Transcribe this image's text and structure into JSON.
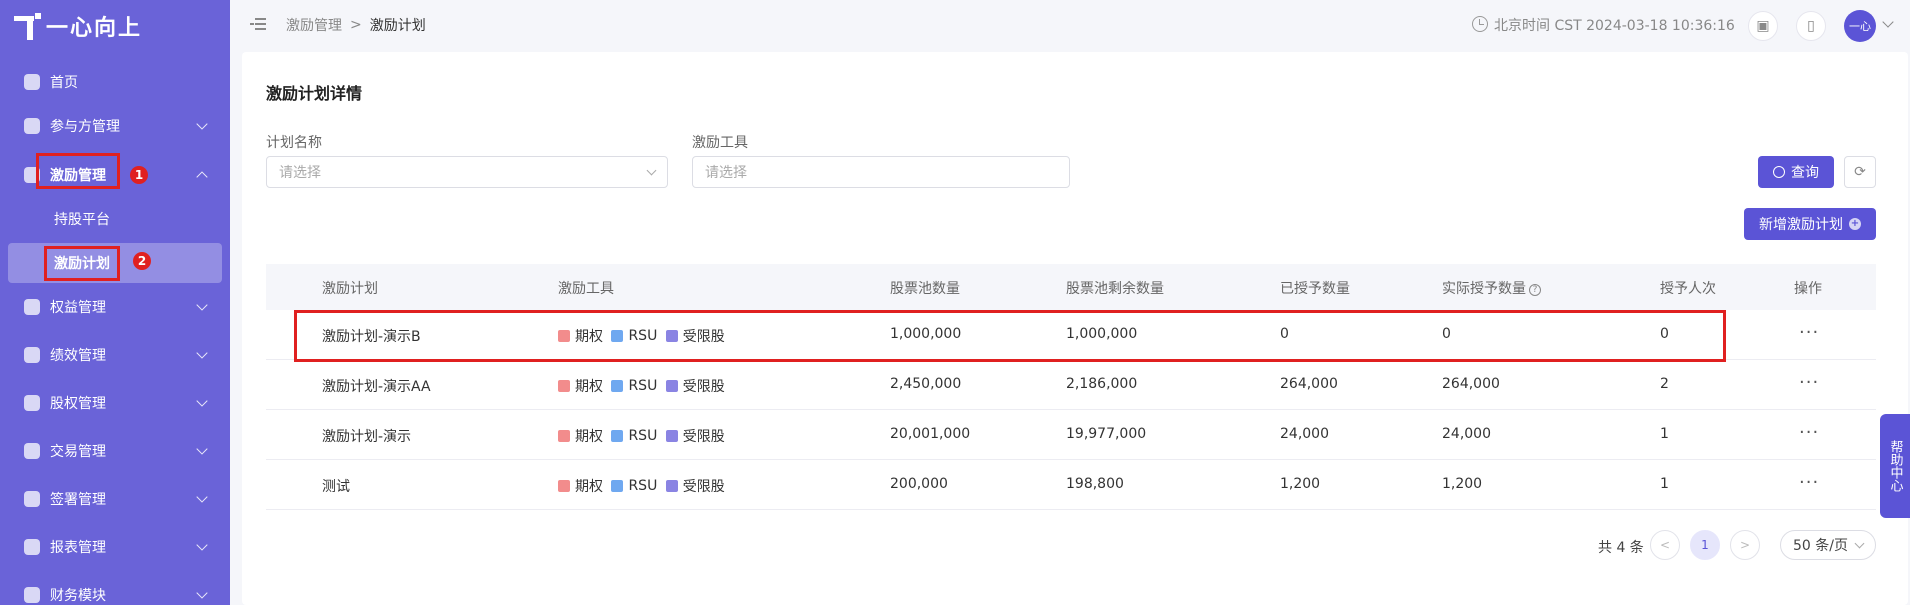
{
  "brand": {
    "logo_text": "一心向上"
  },
  "sidebar": {
    "items": [
      {
        "label": "首页",
        "icon": "home-icon"
      },
      {
        "label": "参与方管理",
        "icon": "participants-icon"
      },
      {
        "label": "激励管理",
        "icon": "incentive-icon",
        "expanded": true
      },
      {
        "label": "权益管理",
        "icon": "equity-rights-icon"
      },
      {
        "label": "绩效管理",
        "icon": "performance-icon"
      },
      {
        "label": "股权管理",
        "icon": "shares-icon"
      },
      {
        "label": "交易管理",
        "icon": "trade-icon"
      },
      {
        "label": "签署管理",
        "icon": "sign-icon"
      },
      {
        "label": "报表管理",
        "icon": "report-icon"
      },
      {
        "label": "财务模块",
        "icon": "finance-icon"
      }
    ],
    "sub_items": [
      {
        "label": "持股平台"
      },
      {
        "label": "激励计划",
        "active": true
      }
    ],
    "annotations": [
      "1",
      "2"
    ]
  },
  "header": {
    "breadcrumb": [
      "激励管理",
      "激励计划"
    ],
    "separator": ">",
    "time_text": "北京时间 CST 2024-03-18 10:36:16",
    "avatar_text": "一心"
  },
  "page": {
    "title": "激励计划详情",
    "filters": {
      "plan_name_label": "计划名称",
      "plan_name_placeholder": "请选择",
      "tool_label": "激励工具",
      "tool_placeholder": "请选择"
    },
    "search_button": "查询",
    "add_button": "新增激励计划"
  },
  "table": {
    "columns": [
      "激励计划",
      "激励工具",
      "股票池数量",
      "股票池剩余数量",
      "已授予数量",
      "实际授予数量",
      "授予人次",
      "操作"
    ],
    "tools": [
      "期权",
      "RSU",
      "受限股"
    ],
    "rows": [
      {
        "plan": "激励计划-演示B",
        "pool": "1,000,000",
        "remaining": "1,000,000",
        "granted": "0",
        "actual": "0",
        "people": "0",
        "action": "···"
      },
      {
        "plan": "激励计划-演示AA",
        "pool": "2,450,000",
        "remaining": "2,186,000",
        "granted": "264,000",
        "actual": "264,000",
        "people": "2",
        "action": "···"
      },
      {
        "plan": "激励计划-演示",
        "pool": "20,001,000",
        "remaining": "19,977,000",
        "granted": "24,000",
        "actual": "24,000",
        "people": "1",
        "action": "···"
      },
      {
        "plan": "测试",
        "pool": "200,000",
        "remaining": "198,800",
        "granted": "1,200",
        "actual": "1,200",
        "people": "1",
        "action": "···"
      }
    ]
  },
  "pagination": {
    "total_text": "共 4 条",
    "prev": "<",
    "current_page": "1",
    "next": ">",
    "page_size": "50 条/页"
  },
  "help_center": "帮助中心",
  "colors": {
    "sidebar": "#6a63d8",
    "primary": "#5b54d6",
    "highlight": "#e02020"
  }
}
